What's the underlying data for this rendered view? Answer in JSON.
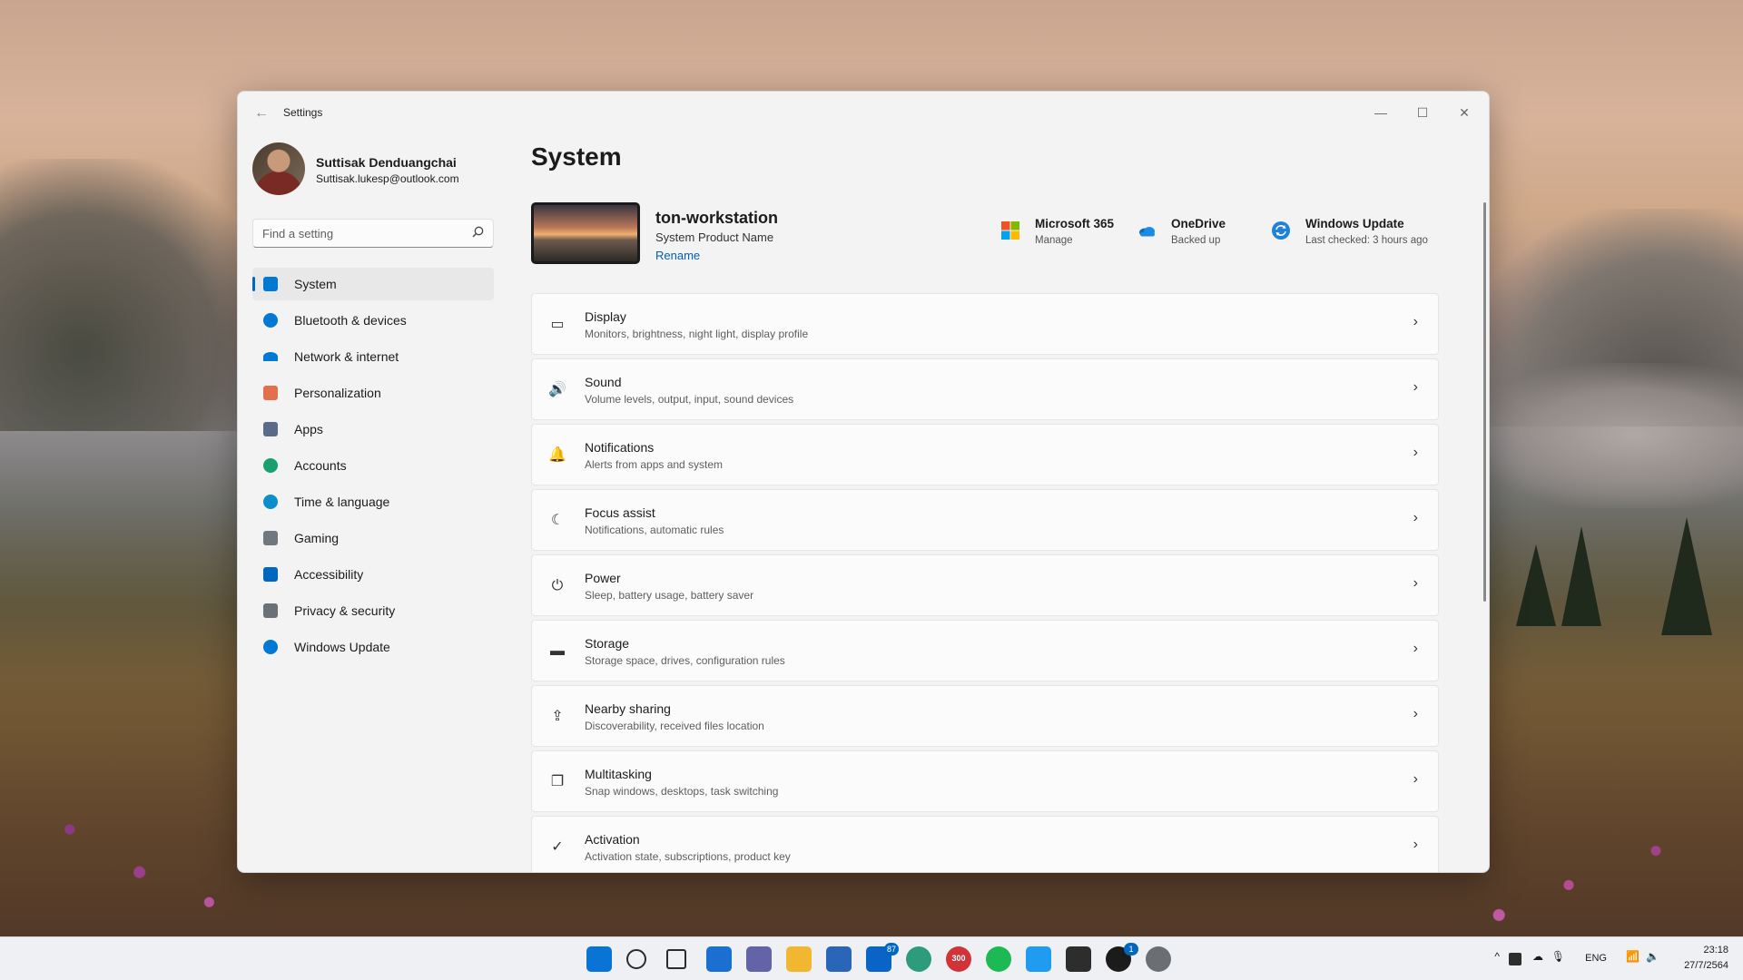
{
  "window": {
    "title": "Settings",
    "back_glyph": "←",
    "controls": [
      "—",
      "☐",
      "✕"
    ]
  },
  "profile": {
    "name": "Suttisak Denduangchai",
    "email": "Suttisak.lukesp@outlook.com"
  },
  "search": {
    "placeholder": "Find a setting"
  },
  "nav": {
    "items": [
      {
        "label": "System",
        "icon": "system-icon",
        "color": "#0078d4"
      },
      {
        "label": "Bluetooth & devices",
        "icon": "bluetooth-icon",
        "color": "#0078d4"
      },
      {
        "label": "Network & internet",
        "icon": "wifi-icon",
        "color": "#0078d4"
      },
      {
        "label": "Personalization",
        "icon": "brush-icon",
        "color": "#e3704c"
      },
      {
        "label": "Apps",
        "icon": "apps-icon",
        "color": "#5a6b8a"
      },
      {
        "label": "Accounts",
        "icon": "accounts-icon",
        "color": "#1aa06d"
      },
      {
        "label": "Time & language",
        "icon": "globe-clock-icon",
        "color": "#0d8ec9"
      },
      {
        "label": "Gaming",
        "icon": "gamepad-icon",
        "color": "#6f7780"
      },
      {
        "label": "Accessibility",
        "icon": "accessibility-icon",
        "color": "#0067c0"
      },
      {
        "label": "Privacy & security",
        "icon": "shield-icon",
        "color": "#6b7178"
      },
      {
        "label": "Windows Update",
        "icon": "update-icon",
        "color": "#0078d4"
      }
    ],
    "active_index": 0
  },
  "main": {
    "title": "System",
    "device": {
      "name": "ton-workstation",
      "model": "System Product Name",
      "rename": "Rename"
    },
    "quick": [
      {
        "title": "Microsoft 365",
        "sub": "Manage",
        "icon": "microsoft-365-icon"
      },
      {
        "title": "OneDrive",
        "sub": "Backed up",
        "icon": "onedrive-icon"
      },
      {
        "title": "Windows Update",
        "sub": "Last checked: 3 hours ago",
        "icon": "windows-update-icon"
      }
    ],
    "cards": [
      {
        "title": "Display",
        "sub": "Monitors, brightness, night light, display profile",
        "icon": "display-icon",
        "glyph": "▭"
      },
      {
        "title": "Sound",
        "sub": "Volume levels, output, input, sound devices",
        "icon": "speaker-icon",
        "glyph": "🔊"
      },
      {
        "title": "Notifications",
        "sub": "Alerts from apps and system",
        "icon": "bell-icon",
        "glyph": "🔔"
      },
      {
        "title": "Focus assist",
        "sub": "Notifications, automatic rules",
        "icon": "moon-icon",
        "glyph": "☾"
      },
      {
        "title": "Power",
        "sub": "Sleep, battery usage, battery saver",
        "icon": "power-icon",
        "glyph": "⏻"
      },
      {
        "title": "Storage",
        "sub": "Storage space, drives, configuration rules",
        "icon": "storage-icon",
        "glyph": "▬"
      },
      {
        "title": "Nearby sharing",
        "sub": "Discoverability, received files location",
        "icon": "share-icon",
        "glyph": "⇪"
      },
      {
        "title": "Multitasking",
        "sub": "Snap windows, desktops, task switching",
        "icon": "multitasking-icon",
        "glyph": "❐"
      },
      {
        "title": "Activation",
        "sub": "Activation state, subscriptions, product key",
        "icon": "check-circle-icon",
        "glyph": "✓"
      }
    ],
    "chevron": "›"
  },
  "taskbar": {
    "apps": [
      {
        "name": "start-icon",
        "color": "#0a74d6"
      },
      {
        "name": "search-icon",
        "color": "#2b2b2b"
      },
      {
        "name": "task-view-icon",
        "color": "#2b2b2b"
      },
      {
        "name": "widgets-icon",
        "color": "#1b6fd0"
      },
      {
        "name": "teams-chat-icon",
        "color": "#6264a7"
      },
      {
        "name": "file-explorer-icon",
        "color": "#f2b731"
      },
      {
        "name": "store-icon",
        "color": "#2a66b8"
      },
      {
        "name": "outlook-icon",
        "color": "#0a64c8",
        "badge": "87"
      },
      {
        "name": "edge-icon",
        "color": "#2d9c7c"
      },
      {
        "name": "app-300-icon",
        "color": "#d13438",
        "badge_text": "300"
      },
      {
        "name": "spotify-icon",
        "color": "#1db954"
      },
      {
        "name": "vscode-icon",
        "color": "#1f9cf0"
      },
      {
        "name": "terminal-icon",
        "color": "#2d2d2d"
      },
      {
        "name": "xbox-icon",
        "color": "#1b1b1b",
        "badge": "1"
      },
      {
        "name": "settings-icon",
        "color": "#6b6f74"
      }
    ],
    "tray": {
      "language": "ENG",
      "time": "23:18",
      "date": "27/7/2564"
    }
  }
}
